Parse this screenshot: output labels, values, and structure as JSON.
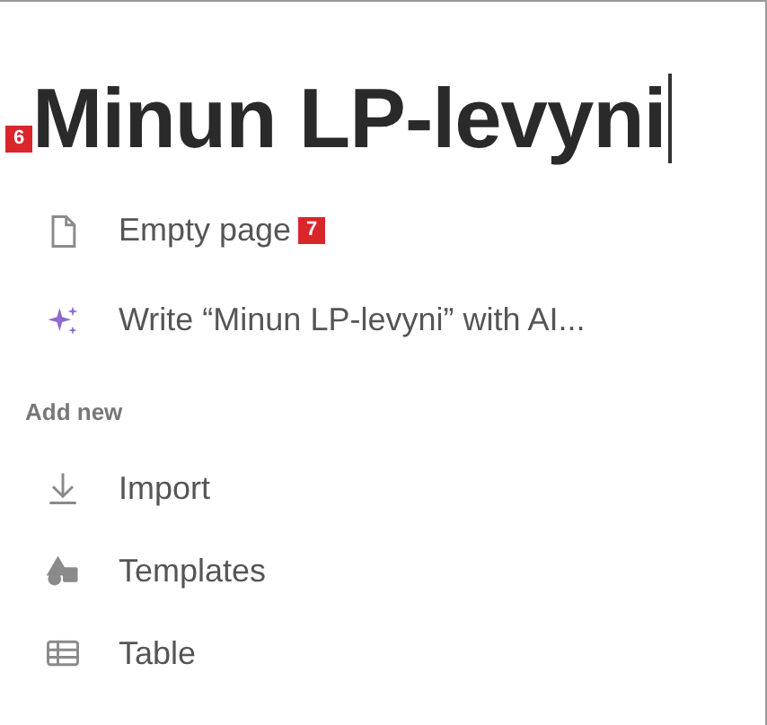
{
  "title": "Minun LP-levyni",
  "title_badge": "6",
  "options": [
    {
      "kind": "empty",
      "label": "Empty page",
      "badge": "7"
    },
    {
      "kind": "ai",
      "label": "Write “Minun LP-levyni” with AI..."
    }
  ],
  "section": "Add new",
  "add_new": [
    {
      "kind": "import",
      "label": "Import"
    },
    {
      "kind": "templates",
      "label": "Templates"
    },
    {
      "kind": "table",
      "label": "Table"
    }
  ]
}
